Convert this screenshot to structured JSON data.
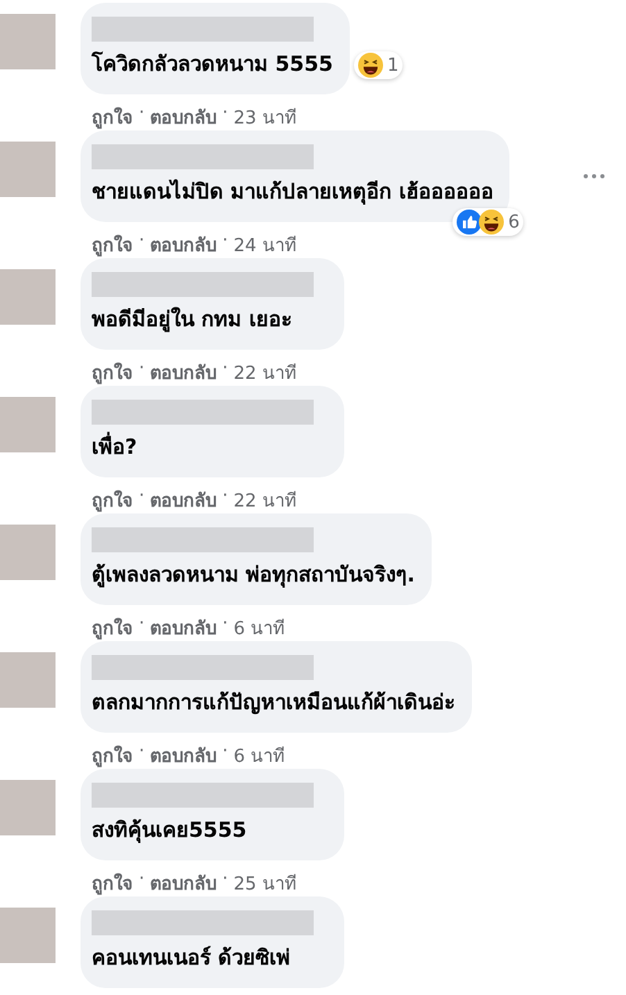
{
  "comments": [
    {
      "text": "โควิดกลัวลวดหนาม 5555",
      "reactions": {
        "kind": "side",
        "icons": [
          {
            "kind": "haha"
          }
        ],
        "count": "1"
      },
      "menu": false,
      "meta": [
        {
          "kind": "action",
          "text": "ถูกใจ"
        },
        {
          "kind": "sep",
          "text": "·"
        },
        {
          "kind": "action",
          "text": "ตอบกลับ"
        },
        {
          "kind": "sep",
          "text": "·"
        },
        {
          "kind": "time",
          "text": "23 นาที"
        }
      ]
    },
    {
      "text": "ชายแดนไม่ปิด มาแก้ปลายเหตุอีก เฮ้ออออออ",
      "reactions": {
        "kind": "corner",
        "icons": [
          {
            "kind": "like"
          },
          {
            "kind": "haha"
          }
        ],
        "count": "6"
      },
      "menu": true,
      "meta": [
        {
          "kind": "action",
          "text": "ถูกใจ"
        },
        {
          "kind": "sep",
          "text": "·"
        },
        {
          "kind": "action",
          "text": "ตอบกลับ"
        },
        {
          "kind": "sep",
          "text": "·"
        },
        {
          "kind": "time",
          "text": "24 นาที"
        }
      ]
    },
    {
      "text": "พอดีมีอยู่ใน กทม เยอะ",
      "menu": false,
      "meta": [
        {
          "kind": "action",
          "text": "ถูกใจ"
        },
        {
          "kind": "sep",
          "text": "·"
        },
        {
          "kind": "action",
          "text": "ตอบกลับ"
        },
        {
          "kind": "sep",
          "text": "·"
        },
        {
          "kind": "time",
          "text": "22 นาที"
        }
      ]
    },
    {
      "text": "เพื่อ?",
      "menu": false,
      "meta": [
        {
          "kind": "action",
          "text": "ถูกใจ"
        },
        {
          "kind": "sep",
          "text": "·"
        },
        {
          "kind": "action",
          "text": "ตอบกลับ"
        },
        {
          "kind": "sep",
          "text": "·"
        },
        {
          "kind": "time",
          "text": "22 นาที"
        }
      ]
    },
    {
      "text": "ตู้เพลงลวดหนาม พ่อทุกสถาบันจริงๆ.",
      "menu": false,
      "meta": [
        {
          "kind": "action",
          "text": "ถูกใจ"
        },
        {
          "kind": "sep",
          "text": "·"
        },
        {
          "kind": "action",
          "text": "ตอบกลับ"
        },
        {
          "kind": "sep",
          "text": "·"
        },
        {
          "kind": "time",
          "text": "6 นาที"
        }
      ]
    },
    {
      "text": "ตลกมากการแก้ปัญหาเหมือนแก้ผ้าเดินอ่ะ",
      "menu": false,
      "meta": [
        {
          "kind": "action",
          "text": "ถูกใจ"
        },
        {
          "kind": "sep",
          "text": "·"
        },
        {
          "kind": "action",
          "text": "ตอบกลับ"
        },
        {
          "kind": "sep",
          "text": "·"
        },
        {
          "kind": "time",
          "text": "6 นาที"
        }
      ]
    },
    {
      "text": "สงทิคุ้นเคย5555",
      "menu": false,
      "meta": [
        {
          "kind": "action",
          "text": "ถูกใจ"
        },
        {
          "kind": "sep",
          "text": "·"
        },
        {
          "kind": "action",
          "text": "ตอบกลับ"
        },
        {
          "kind": "sep",
          "text": "·"
        },
        {
          "kind": "time",
          "text": "25 นาที"
        }
      ]
    },
    {
      "text": "คอนเทนเนอร์ ด้วยซิเพ่",
      "menu": false
    }
  ]
}
